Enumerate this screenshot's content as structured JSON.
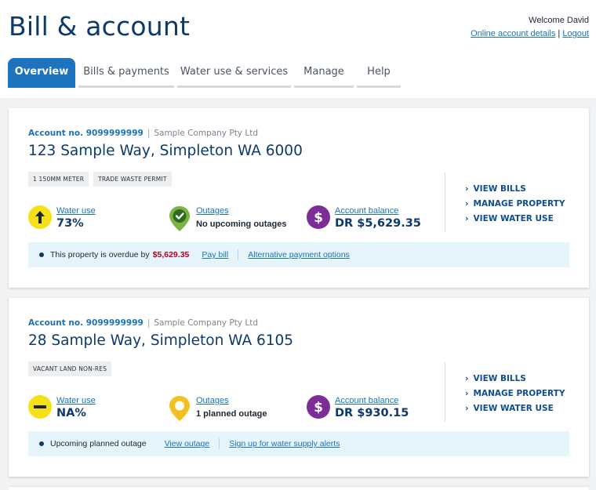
{
  "header": {
    "title": "Bill & account",
    "welcome": "Welcome David",
    "online_account_link": "Online account details",
    "separator": "|",
    "logout_link": "Logout"
  },
  "tabs": [
    {
      "label": "Overview",
      "active": true
    },
    {
      "label": "Bills & payments",
      "active": false
    },
    {
      "label": "Water use & services",
      "active": false
    },
    {
      "label": "Manage",
      "active": false
    },
    {
      "label": "Help",
      "active": false
    }
  ],
  "accounts": [
    {
      "account_label": "Account no. 9099999999",
      "company": "Sample Company Pty Ltd",
      "address": "123 Sample Way, Simpleton WA 6000",
      "tags": [
        "1 150MM METER",
        "TRADE WASTE PERMIT"
      ],
      "water_use": {
        "label": "Water use",
        "value": "73%",
        "icon": "arrow-up-icon",
        "color": "#f5e01a"
      },
      "outages": {
        "label": "Outages",
        "value": "No upcoming outages",
        "icon": "check-pin-icon",
        "color": "#7cb342"
      },
      "balance": {
        "label": "Account balance",
        "value": "DR $5,629.35",
        "icon": "dollar-icon",
        "color": "#7b2f96"
      },
      "actions": [
        "VIEW BILLS",
        "MANAGE PROPERTY",
        "VIEW WATER USE"
      ],
      "alert": {
        "text": "This property is overdue by",
        "amount": "$5,629.35",
        "link1": "Pay bill",
        "link2": "Alternative payment options"
      }
    },
    {
      "account_label": "Account no. 9099999999",
      "company": "Sample Company Pty Ltd",
      "address": "28 Sample Way, Simpleton WA 6105",
      "tags": [
        "VACANT LAND NON-RES"
      ],
      "water_use": {
        "label": "Water use",
        "value": "NA%",
        "icon": "minus-icon",
        "color": "#f5e01a"
      },
      "outages": {
        "label": "Outages",
        "value": "1 planned outage",
        "icon": "pin-icon",
        "color": "#f4c020"
      },
      "balance": {
        "label": "Account balance",
        "value": "DR $930.15",
        "icon": "dollar-icon",
        "color": "#7b2f96"
      },
      "actions": [
        "VIEW BILLS",
        "MANAGE PROPERTY",
        "VIEW WATER USE"
      ],
      "alert": {
        "text": "Upcoming planned outage",
        "link1": "View outage",
        "link2": "Sign up for water supply alerts"
      }
    }
  ],
  "colors": {
    "brand_blue": "#1e73be",
    "navy": "#0e3a6b",
    "link": "#1a73b8",
    "overdue_red": "#b3001b"
  }
}
